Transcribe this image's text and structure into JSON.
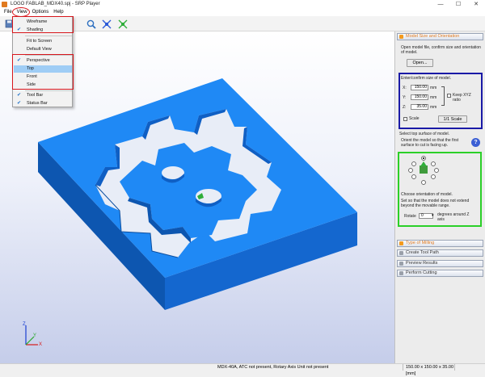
{
  "window": {
    "title": "LOGO FABLAB_MDX40.spj - SRP Player",
    "buttons": [
      "—",
      "☐",
      "✕"
    ]
  },
  "menubar": {
    "items": [
      "File",
      "View",
      "Options",
      "Help"
    ]
  },
  "view_menu": {
    "items": [
      {
        "label": "Wireframe",
        "checked": false
      },
      {
        "label": "Shading",
        "checked": true
      },
      {
        "label": "Fit to Screen",
        "checked": false
      },
      {
        "label": "Default View",
        "checked": false
      },
      {
        "label": "Perspective",
        "checked": true
      },
      {
        "label": "Top",
        "checked": false,
        "highlighted": true
      },
      {
        "label": "Front",
        "checked": false
      },
      {
        "label": "Side",
        "checked": false
      },
      {
        "label": "Tool Bar",
        "checked": true
      },
      {
        "label": "Status Bar",
        "checked": true
      }
    ],
    "check_glyph": "✔"
  },
  "toolbar": {
    "icons": [
      "save-icon",
      "zoom-icon",
      "fit-icon",
      "fit-all-icon"
    ]
  },
  "axes": {
    "x": "X",
    "y": "Y",
    "z": "Z"
  },
  "panel": {
    "section1": {
      "title": "Model Size and Orientation",
      "open_text": "Open model file, confirm size and orientation of model.",
      "open_button": "Open...",
      "size_text": "Enter/confirm size of model.",
      "x_label": "X:",
      "x_value": "150.00",
      "x_unit": "mm",
      "y_label": "Y:",
      "y_value": "150.00",
      "y_unit": "mm",
      "z_label": "Z:",
      "z_value": "35.00",
      "z_unit": "mm",
      "keep_ratio": "Keep XYZ ratio",
      "scale_label": "Scale",
      "scale_button": "1/1 Scale",
      "surface_text": "Select top surface of model.",
      "orient_text": "Orient the model so that the first surface to cut is facing up.",
      "help_glyph": "?",
      "choose_text": "Choose orientation of model.",
      "set_text": "Set so that the model does not extend beyond the movable range.",
      "rotate_label": "Rotate",
      "rotate_value": "0",
      "rotate_unit": "degrees around Z axis"
    },
    "steps": [
      "Type of Milling",
      "Create Tool Path",
      "Preview Results",
      "Perform Cutting"
    ]
  },
  "statusbar": {
    "message": "MDX-40A, ATC not present, Rotary Axis Unit not present",
    "dimensions": "150.00 x 150.00 x 35.00 [mm]"
  },
  "colors": {
    "model_top": "#1f89f5",
    "model_side": "#0f5ec0",
    "annotation_red": "#d8161c",
    "annotation_blue": "#1a1aa6",
    "annotation_green": "#2bd028"
  }
}
